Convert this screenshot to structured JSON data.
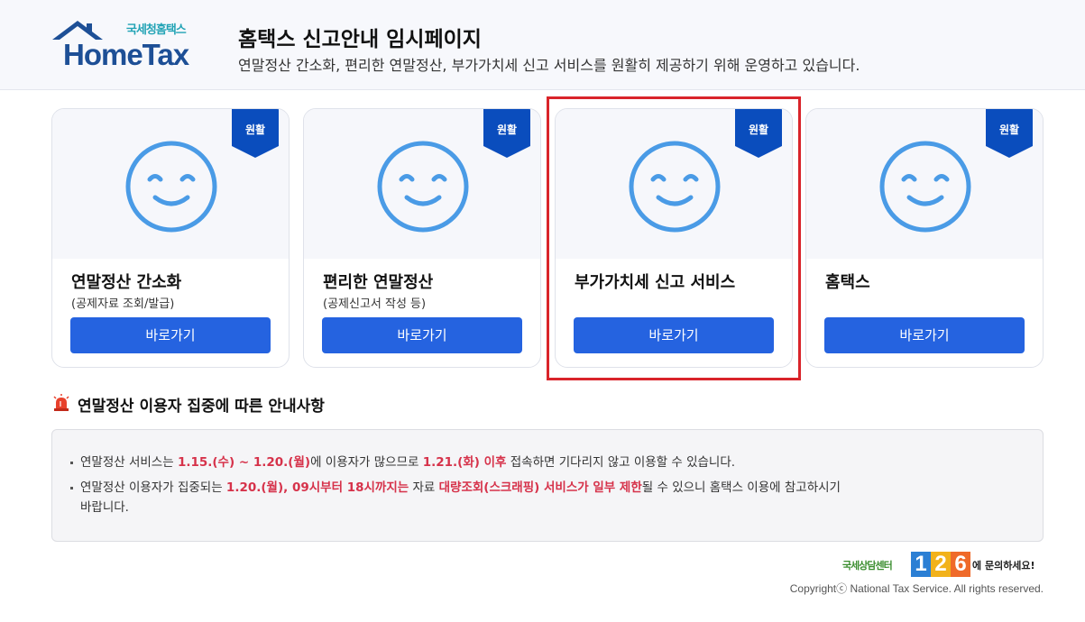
{
  "header": {
    "logo_small": "국세청홈택스",
    "logo_big": "HomeTax",
    "title": "홈택스 신고안내 임시페이지",
    "subtitle": "연말정산 간소화, 편리한 연말정산, 부가가치세 신고 서비스를 원활히 제공하기 위해 운영하고 있습니다."
  },
  "cards": [
    {
      "status": "원활",
      "title": "연말정산 간소화",
      "sub": "(공제자료 조회/발급)",
      "button": "바로가기"
    },
    {
      "status": "원활",
      "title": "편리한 연말정산",
      "sub": "(공제신고서 작성 등)",
      "button": "바로가기"
    },
    {
      "status": "원활",
      "title": "부가가치세 신고 서비스",
      "sub": "",
      "button": "바로가기"
    },
    {
      "status": "원활",
      "title": "홈택스",
      "sub": "",
      "button": "바로가기"
    }
  ],
  "notice": {
    "title": "연말정산 이용자 집중에 따른 안내사항",
    "line1": {
      "t1": "연말정산 서비스는 ",
      "b1": "1.15.(수) ~ 1.20.(월)",
      "t2": "에 이용자가 많으므로 ",
      "b2": "1.21.(화) 이후",
      "t3": " 접속하면 기다리지 않고 이용할 수 있습니다."
    },
    "line2": {
      "t1": "연말정산 이용자가 집중되는 ",
      "b1": "1.20.(월), 09시부터 18시까지는",
      "t2": " 자료 ",
      "b2": "대량조회(스크래핑) 서비스가 일부 제한",
      "t3": "될 수 있으니 홈택스 이용에 참고하시기",
      "t4": "바랍니다."
    }
  },
  "footer": {
    "cs_prefix": "국세상담센터",
    "cs_digits": [
      "1",
      "2",
      "6"
    ],
    "cs_suffix": "에 문의하세요!",
    "copyright": "Copyrightⓒ National Tax Service. All rights reserved."
  },
  "colors": {
    "primary_button": "#2563e0",
    "ribbon": "#0a4dbd",
    "highlight": "#d9242a",
    "emphasis": "#d6324a",
    "smile": "#4a9be6"
  }
}
